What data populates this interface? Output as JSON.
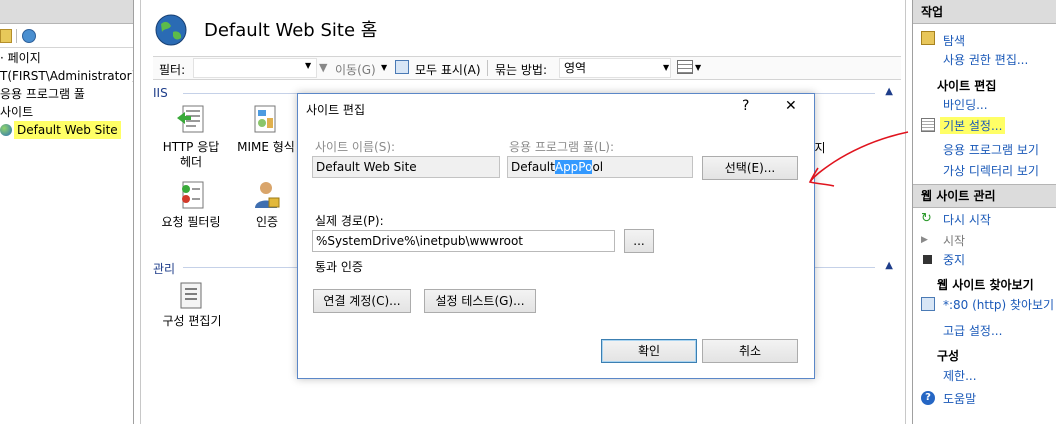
{
  "tree": {
    "items": [
      {
        "label": "· 페이지"
      },
      {
        "label": "T(FIRST\\Administrator)"
      },
      {
        "label": "응용 프로그램 풀"
      },
      {
        "label": "사이트"
      },
      {
        "label": "Default Web Site"
      }
    ]
  },
  "center": {
    "title": "Default Web Site 홈",
    "filter": {
      "label": "필터:",
      "go_label": "이동(G)",
      "show_all_label": "모두 표시(A)",
      "group_label": "묶는 방법:",
      "group_value": "영역"
    },
    "sections": [
      {
        "name": "IIS"
      },
      {
        "name": "관리"
      }
    ],
    "features": {
      "http_headers": "HTTP 응답\n헤더",
      "mime": "MIME 형식",
      "request_filter": "요청 필터링",
      "auth": "인증",
      "config_editor": "구성 편집기",
      "partial_right": "지"
    }
  },
  "dialog": {
    "title": "사이트 편집",
    "help": "?",
    "close": "✕",
    "site_name_label": "사이트 이름(S):",
    "site_name_value": "Default Web Site",
    "app_pool_label": "응용 프로그램 풀(L):",
    "app_pool_value_pre": "Default",
    "app_pool_value_sel": "AppPo",
    "app_pool_value_post": "ol",
    "select_button": "선택(E)...",
    "path_label": "실제 경로(P):",
    "path_value": "%SystemDrive%\\inetpub\\wwwroot",
    "browse_button": "...",
    "passthrough_label": "통과 인증",
    "connect_as_button": "연결 계정(C)...",
    "test_settings_button": "설정 테스트(G)...",
    "ok_button": "확인",
    "cancel_button": "취소"
  },
  "actions": {
    "header": "작업",
    "explore": "탐색",
    "edit_permissions": "사용 권한 편집...",
    "site_edit_section": "사이트 편집",
    "bindings": "바인딩...",
    "basic_settings": "기본 설정...",
    "view_app": "응용 프로그램 보기",
    "view_vdir": "가상 디렉터리 보기",
    "manage_section": "웹 사이트 관리",
    "restart": "다시 시작",
    "start": "시작",
    "stop": "중지",
    "browse_section": "웹 사이트 찾아보기",
    "browse_link": "*:80 (http) 찾아보기",
    "advanced": "고급 설정...",
    "config_section": "구성",
    "limits": "제한...",
    "help": "도움말"
  },
  "colors": {
    "link": "#1a59b8",
    "selection": "#3399ff",
    "highlight": "#ffff66",
    "annotation": "#e0141e"
  }
}
